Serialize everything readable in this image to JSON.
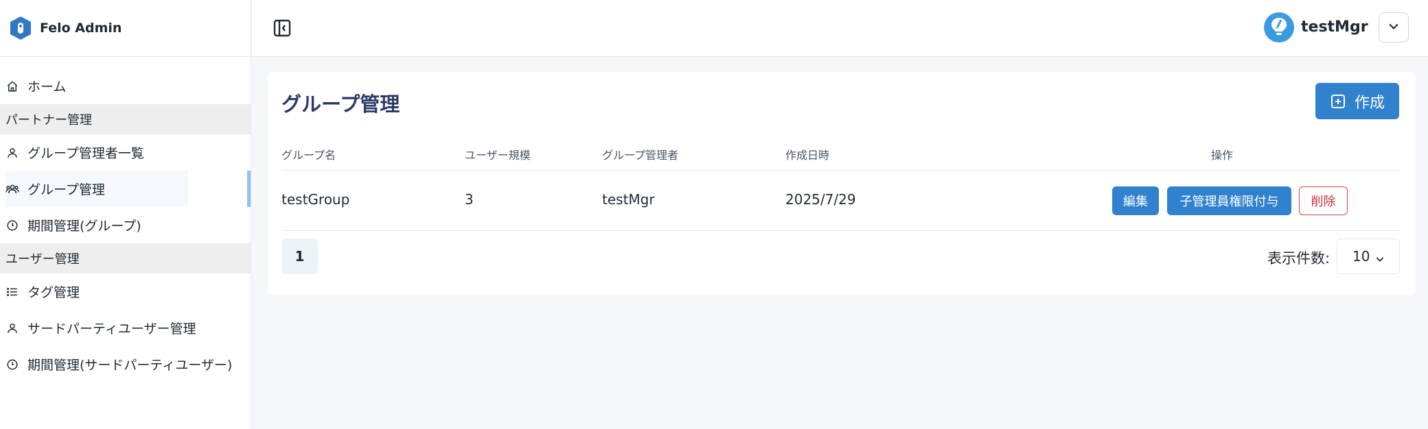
{
  "brand": {
    "name": "Felo Admin"
  },
  "sidebar": {
    "items": [
      {
        "type": "item",
        "label": "ホーム",
        "icon": "home-icon"
      },
      {
        "type": "section",
        "label": "パートナー管理"
      },
      {
        "type": "item",
        "label": "グループ管理者一覧",
        "icon": "user-icon"
      },
      {
        "type": "item",
        "label": "グループ管理",
        "icon": "users-icon",
        "active": true
      },
      {
        "type": "item",
        "label": "期間管理(グループ)",
        "icon": "clock-icon"
      },
      {
        "type": "section",
        "label": "ユーザー管理"
      },
      {
        "type": "item",
        "label": "タグ管理",
        "icon": "list-icon"
      },
      {
        "type": "item",
        "label": "サードパーティユーザー管理",
        "icon": "user-icon"
      },
      {
        "type": "item",
        "label": "期間管理(サードパーティユーザー)",
        "icon": "clock-icon"
      }
    ]
  },
  "header": {
    "username": "testMgr"
  },
  "main": {
    "title": "グループ管理",
    "create_label": "作成",
    "columns": [
      "グループ名",
      "ユーザー規模",
      "グループ管理者",
      "作成日時",
      "操作"
    ],
    "rows": [
      {
        "group_name": "testGroup",
        "user_scale": "3",
        "admin": "testMgr",
        "created_at": "2025/7/29",
        "actions": {
          "edit": "編集",
          "grant": "子管理員権限付与",
          "delete": "削除"
        }
      }
    ],
    "pagination": {
      "current_page": "1",
      "page_size_label": "表示件数:",
      "page_size": "10"
    }
  },
  "colors": {
    "primary": "#3182ce",
    "danger": "#e53e3e",
    "title": "#2d3a66",
    "active_bar": "#90c2ef"
  }
}
